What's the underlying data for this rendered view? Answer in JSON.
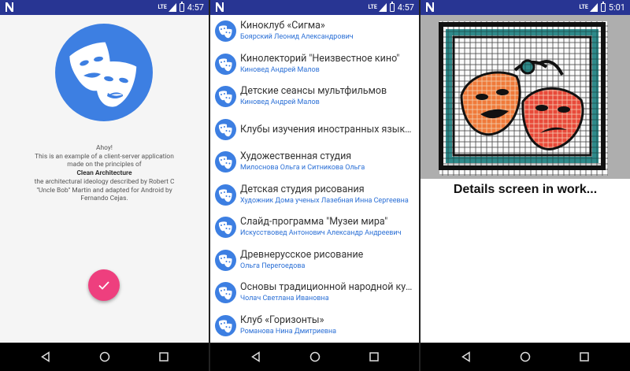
{
  "status": {
    "network": "LTE",
    "time1": "4:57",
    "time2": "4:57",
    "time3": "5:01"
  },
  "about": {
    "greeting": "Ahoy!",
    "line1": "This is an example of a client-server application",
    "line2": "made on the principles of",
    "bold": "Clean Architecture",
    "line3": "the architectural ideology described by Robert C",
    "line4": "\"Uncle Bob\" Martin and adapted for Android by",
    "line5": "Fernando Cejas."
  },
  "list": [
    {
      "title": "Киноклуб «Сигма»",
      "subtitle": "Боярский Леонид Александрович"
    },
    {
      "title": "Кинолекторий \"Неизвестное кино\"",
      "subtitle": "Киновед Андрей Малов"
    },
    {
      "title": "Детские сеансы мультфильмов",
      "subtitle": "Киновед  Андрей Малов"
    },
    {
      "title": "Клубы изучения иностранных языков",
      "subtitle": ""
    },
    {
      "title": "Художественная студия",
      "subtitle": "Милоснова Ольга и Ситникова Ольга"
    },
    {
      "title": "Детская студия рисования",
      "subtitle": "Художник Дома ученых Лазебная Инна Сергеевна"
    },
    {
      "title": "Слайд-программа \"Музеи мира\"",
      "subtitle": "Искусствовед Антонович Александр Андреевич"
    },
    {
      "title": "Древнерусское рисование",
      "subtitle": "Ольга Перегоедова"
    },
    {
      "title": "Основы традиционной народной культуры",
      "subtitle": "Чолач Светлана Ивановна"
    },
    {
      "title": "Клуб «Горизонты»",
      "subtitle": "Романова Нина Дмитриевна"
    }
  ],
  "details": {
    "placeholder": "Details screen in work..."
  },
  "colors": {
    "status_bar": "#283593",
    "accent": "#3d7fe2",
    "fab": "#ee3f7e",
    "subtitle": "#2a6fd6"
  },
  "icons": {
    "logo": "theater-masks-icon",
    "fab": "check-icon",
    "nav_back": "back-triangle-icon",
    "nav_home": "home-circle-icon",
    "nav_recents": "recents-square-icon"
  }
}
